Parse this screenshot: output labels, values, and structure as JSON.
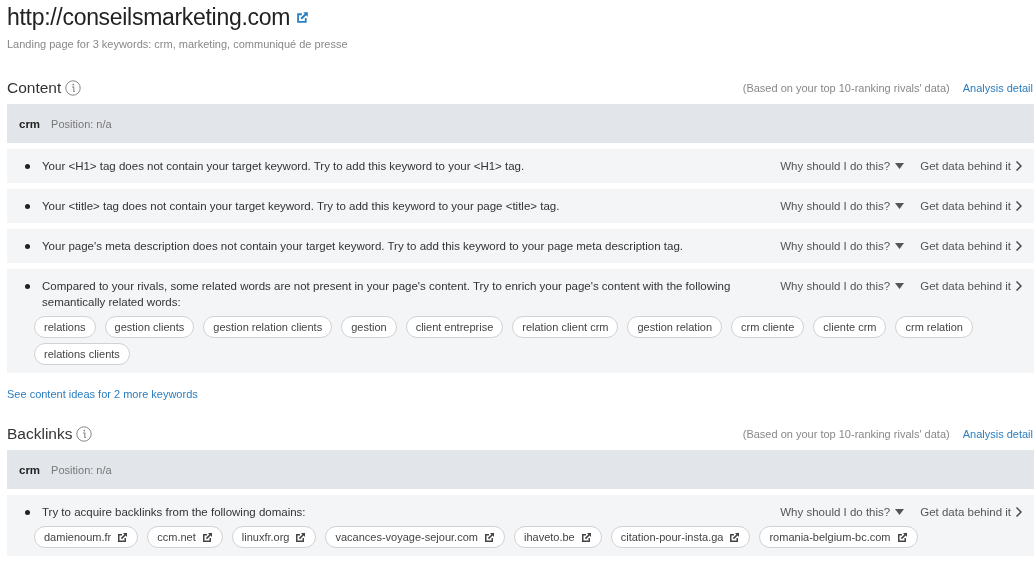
{
  "page": {
    "url": "http://conseilsmarketing.com",
    "subtitle": "Landing page for 3 keywords: crm, marketing, communiqué de presse"
  },
  "sections": [
    {
      "title": "Content",
      "note": "(Based on your top 10-ranking rivals' data)",
      "link": "Analysis detail",
      "keyword": "crm",
      "position": "Position: n/a",
      "tips": [
        {
          "text": "Your <H1> tag does not contain your target keyword. Try to add this keyword to your <H1> tag.",
          "why": "Why should I do this?",
          "data": "Get data behind it"
        },
        {
          "text": "Your <title> tag does not contain your target keyword. Try to add this keyword to your page <title> tag.",
          "why": "Why should I do this?",
          "data": "Get data behind it"
        },
        {
          "text": "Your page's meta description does not contain your target keyword. Try to add this keyword to your page meta description tag.",
          "why": "Why should I do this?",
          "data": "Get data behind it"
        },
        {
          "text": "Compared to your rivals, some related words are not present in your page's content. Try to enrich your page's content with the following semantically related words:",
          "why": "Why should I do this?",
          "data": "Get data behind it",
          "tags": [
            {
              "label": "relations",
              "external": false
            },
            {
              "label": "gestion clients",
              "external": false
            },
            {
              "label": "gestion relation clients",
              "external": false
            },
            {
              "label": "gestion",
              "external": false
            },
            {
              "label": "client entreprise",
              "external": false
            },
            {
              "label": "relation client crm",
              "external": false
            },
            {
              "label": "gestion relation",
              "external": false
            },
            {
              "label": "crm cliente",
              "external": false
            },
            {
              "label": "cliente crm",
              "external": false
            },
            {
              "label": "crm relation",
              "external": false
            },
            {
              "label": "relations clients",
              "external": false
            }
          ]
        }
      ],
      "more_link": "See content ideas for 2 more keywords"
    },
    {
      "title": "Backlinks",
      "note": "(Based on your top 10-ranking rivals' data)",
      "link": "Analysis detail",
      "keyword": "crm",
      "position": "Position: n/a",
      "tips": [
        {
          "text": "Try to acquire backlinks from the following domains:",
          "why": "Why should I do this?",
          "data": "Get data behind it",
          "tags": [
            {
              "label": "damienoum.fr",
              "external": true
            },
            {
              "label": "ccm.net",
              "external": true
            },
            {
              "label": "linuxfr.org",
              "external": true
            },
            {
              "label": "vacances-voyage-sejour.com",
              "external": true
            },
            {
              "label": "ihaveto.be",
              "external": true
            },
            {
              "label": "citation-pour-insta.ga",
              "external": true
            },
            {
              "label": "romania-belgium-bc.com",
              "external": true
            }
          ]
        }
      ]
    }
  ]
}
